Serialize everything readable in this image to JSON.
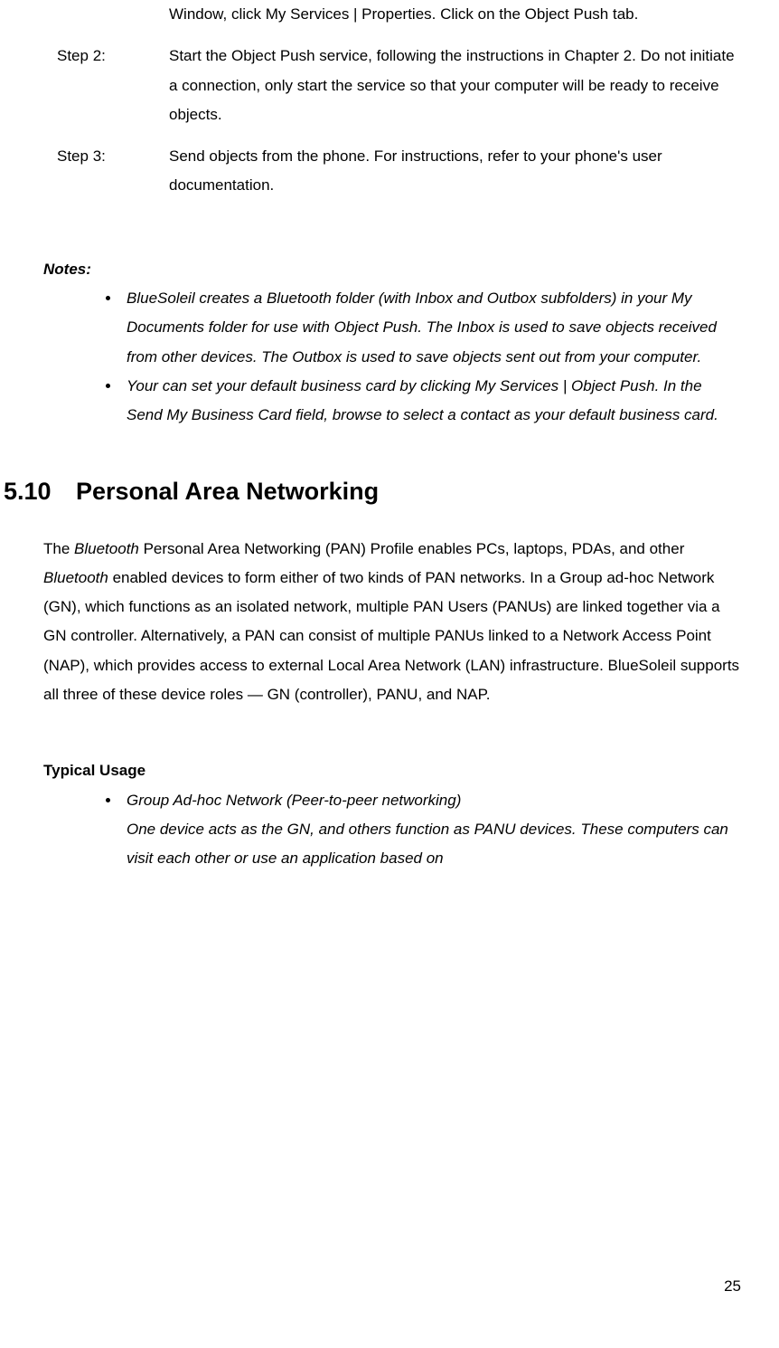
{
  "steps": {
    "step1_text": "Window, click My Services | Properties. Click on the Object Push tab.",
    "step2_label": "Step 2:",
    "step2_text": "Start the Object Push service, following the instructions in Chapter 2. Do not initiate a connection, only start the service so that your computer will be ready to receive objects.",
    "step3_label": "Step 3:",
    "step3_text": "Send objects from the phone. For instructions, refer to your phone's user documentation."
  },
  "notes": {
    "heading": "Notes:",
    "item1": "BlueSoleil creates a Bluetooth folder (with Inbox and Outbox subfolders) in your My Documents folder for use with Object Push. The Inbox is used to save objects received from other devices. The Outbox is used to save objects sent out from your computer.",
    "item2": "Your can set your default business card by clicking My Services | Object Push. In the Send My Business Card field, browse to select a contact as your default business card."
  },
  "section": {
    "num": "5.10",
    "title": "Personal Area Networking",
    "para_pre": "The ",
    "para_bt1": "Bluetooth",
    "para_mid1": " Personal Area Networking (PAN) Profile enables PCs, laptops, PDAs, and other ",
    "para_bt2": "Bluetooth",
    "para_post": " enabled devices to form either of two kinds of PAN networks. In a Group ad-hoc Network (GN), which functions as an isolated network, multiple PAN Users (PANUs) are linked together via a GN controller. Alternatively, a PAN can consist of multiple PANUs linked to a Network Access Point (NAP), which provides access to external Local Area Network (LAN) infrastructure. BlueSoleil supports all three of these device roles — GN (controller), PANU, and NAP."
  },
  "typical": {
    "heading": "Typical Usage",
    "item1_title": "Group Ad-hoc Network (Peer-to-peer networking)",
    "item1_body": "One device acts as the GN, and others function as PANU devices. These computers can visit each other or use an application based on"
  },
  "page_number": "25"
}
